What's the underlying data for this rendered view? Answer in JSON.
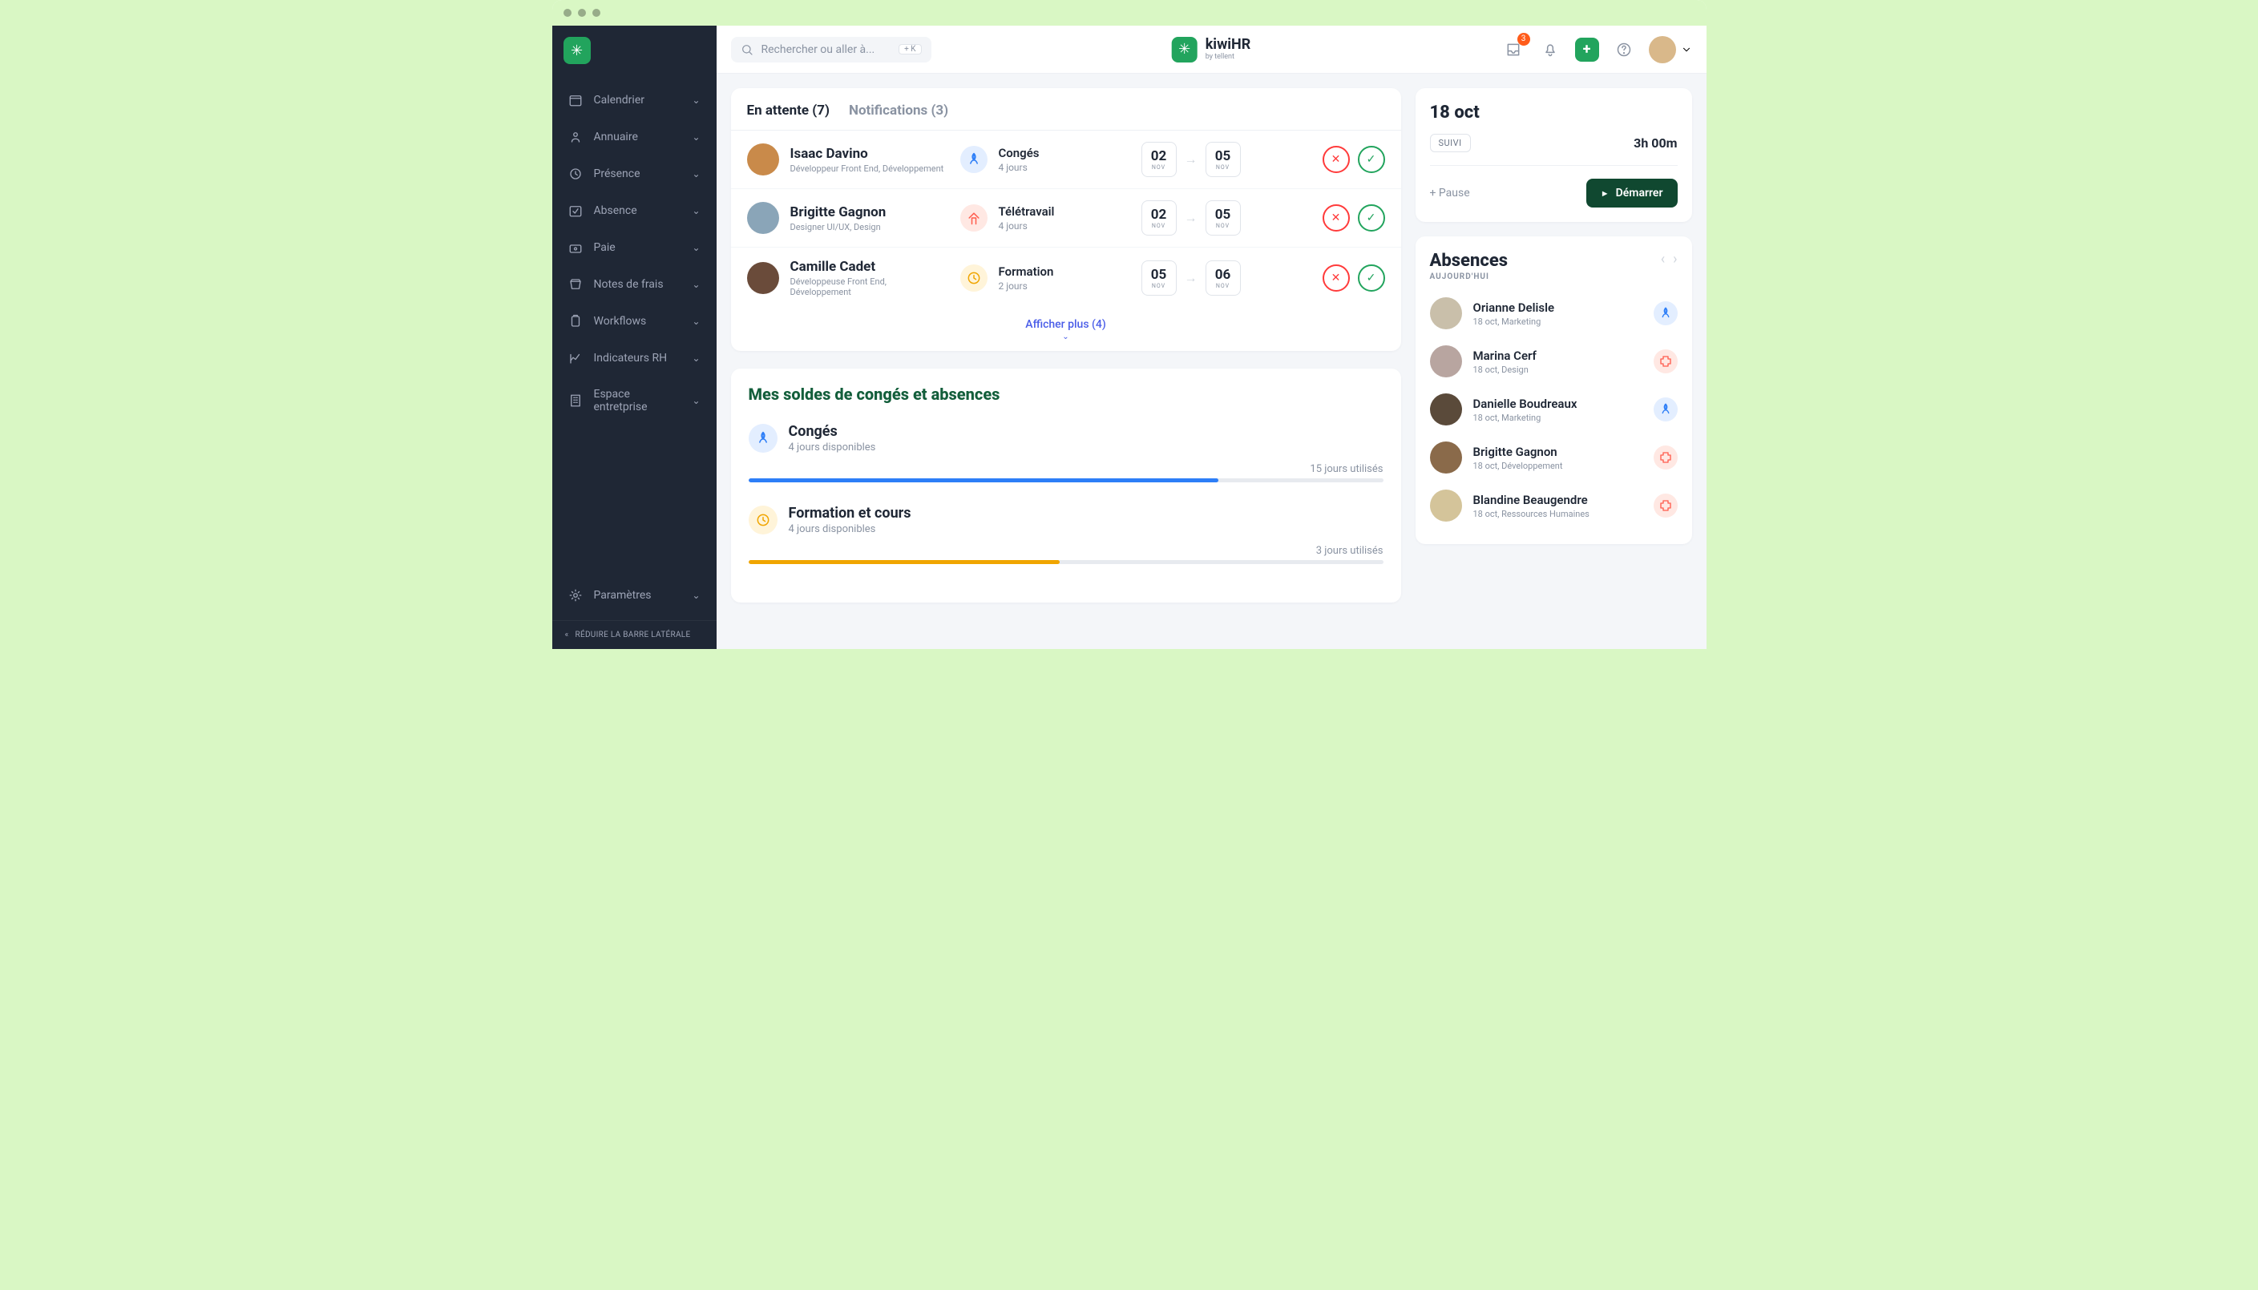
{
  "search": {
    "placeholder": "Rechercher ou aller à...",
    "shortcut": "+ K"
  },
  "brand": {
    "name": "kiwiHR",
    "by": "by tellent"
  },
  "topbar": {
    "notif_badge": "3"
  },
  "sidebar": {
    "items": [
      {
        "label": "Calendrier"
      },
      {
        "label": "Annuaire"
      },
      {
        "label": "Présence"
      },
      {
        "label": "Absence"
      },
      {
        "label": "Paie"
      },
      {
        "label": "Notes de frais"
      },
      {
        "label": "Workflows"
      },
      {
        "label": "Indicateurs RH"
      },
      {
        "label": "Espace entretprise"
      },
      {
        "label": "Paramètres"
      }
    ],
    "collapse": "RÉDUIRE LA BARRE LATÉRALE"
  },
  "tabs": {
    "pending": "En attente (7)",
    "notifs": "Notifications (3)"
  },
  "requests": [
    {
      "name": "Isaac Davino",
      "title": "Développeur Front End, Développement",
      "type": "Congés",
      "dur": "4 jours",
      "d1": "02",
      "d2": "05",
      "m": "NOV",
      "kind": "blue",
      "avatar": "#c98a4a"
    },
    {
      "name": "Brigitte Gagnon",
      "title": "Designer UI/UX, Design",
      "type": "Télétravail",
      "dur": "4 jours",
      "d1": "02",
      "d2": "05",
      "m": "NOV",
      "kind": "red",
      "avatar": "#8aa5b8"
    },
    {
      "name": "Camille Cadet",
      "title": "Développeuse Front End, Développement",
      "type": "Formation",
      "dur": "2 jours",
      "d1": "05",
      "d2": "06",
      "m": "NOV",
      "kind": "yellow",
      "avatar": "#6a4b3a"
    }
  ],
  "showmore": "Afficher plus (4)",
  "balances": {
    "title": "Mes soldes de congés et absences",
    "items": [
      {
        "name": "Congés",
        "sub": "4 jours disponibles",
        "used": "15 jours utilisés",
        "kind": "blue"
      },
      {
        "name": "Formation et cours",
        "sub": "4 jours disponibles",
        "used": "3 jours utilisés",
        "kind": "yellow"
      }
    ]
  },
  "tracking": {
    "date": "18 oct",
    "tag": "SUIVI",
    "time": "3h 00m",
    "pause": "+ Pause",
    "start": "Démarrer"
  },
  "absences": {
    "title": "Absences",
    "sub": "AUJOURD'HUI",
    "items": [
      {
        "name": "Orianne Delisle",
        "det": "18 oct, Marketing",
        "kind": "blue",
        "avatar": "#c9bfaa"
      },
      {
        "name": "Marina Cerf",
        "det": "18 oct, Design",
        "kind": "red",
        "avatar": "#b8a5a0"
      },
      {
        "name": "Danielle Boudreaux",
        "det": "18 oct, Marketing",
        "kind": "blue",
        "avatar": "#5a4a3a"
      },
      {
        "name": "Brigitte Gagnon",
        "det": "18 oct, Développement",
        "kind": "red",
        "avatar": "#8a6a4a"
      },
      {
        "name": "Blandine Beaugendre",
        "det": "18 oct, Ressources Humaines",
        "kind": "red",
        "avatar": "#d4c49a"
      }
    ]
  }
}
